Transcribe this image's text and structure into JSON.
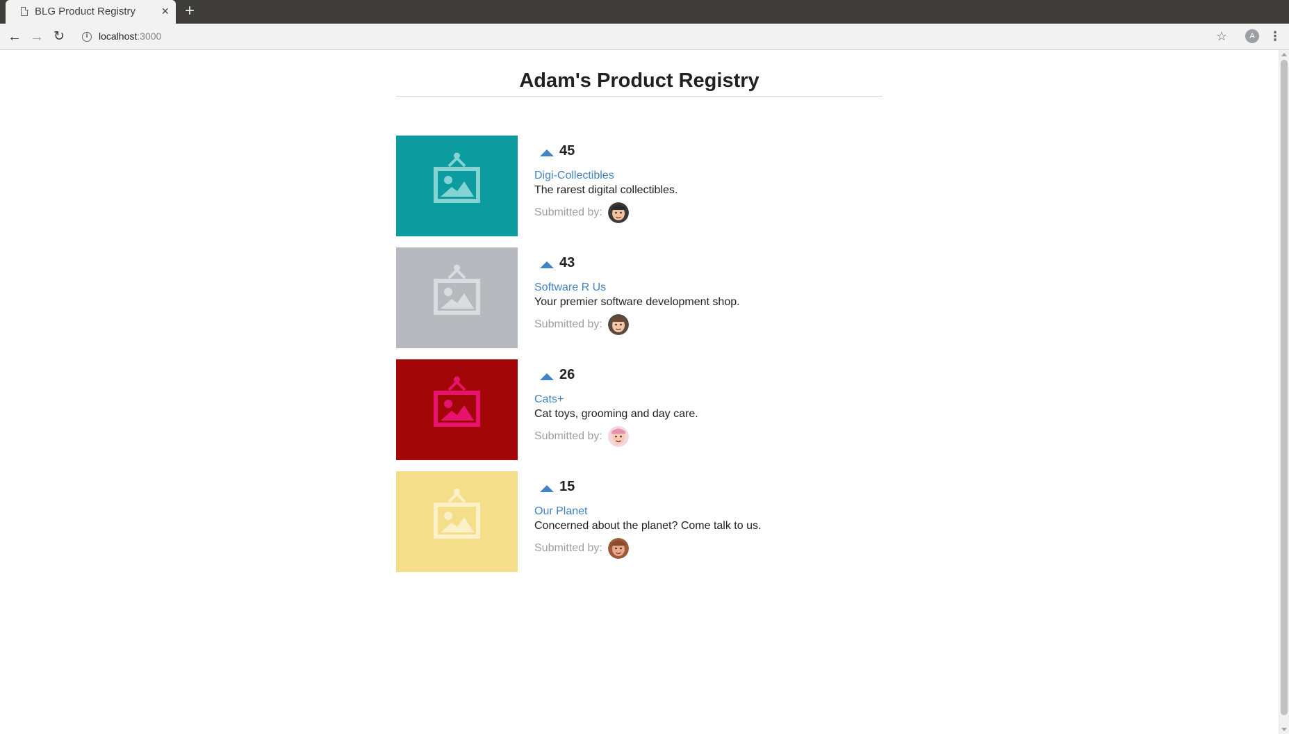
{
  "browser": {
    "tab_title": "BLG Product Registry",
    "tab_close": "×",
    "new_tab": "+",
    "url_host": "localhost",
    "url_port": ":3000",
    "profile_initial": "A",
    "icons": {
      "back": "back-arrow-icon",
      "forward": "forward-arrow-icon",
      "reload": "reload-icon",
      "info": "info-icon",
      "star": "star-icon",
      "menu": "kebab-menu-icon"
    }
  },
  "page": {
    "title": "Adam's Product Registry"
  },
  "products": [
    {
      "votes": "45",
      "title": "Digi-Collectibles",
      "description": "The rarest digital collectibles.",
      "submitted_label": "Submitted by:",
      "image_bg": "#0c9ca0",
      "image_fg": "#86d3d4",
      "avatar": {
        "skin": "#f2c29c",
        "hair": "#2b2b2b",
        "bg": "#3a3a3a"
      }
    },
    {
      "votes": "43",
      "title": "Software R Us",
      "description": "Your premier software development shop.",
      "submitted_label": "Submitted by:",
      "image_bg": "#b6b9be",
      "image_fg": "#dbdcdf",
      "avatar": {
        "skin": "#f3c6a6",
        "hair": "#6b4a33",
        "bg": "#5a4a3e"
      }
    },
    {
      "votes": "26",
      "title": "Cats+",
      "description": "Cat toys, grooming and day care.",
      "submitted_label": "Submitted by:",
      "image_bg": "#a30606",
      "image_fg": "#e8136e",
      "avatar": {
        "skin": "#f6c9b0",
        "hair": "#e58fb1",
        "bg": "#f3d7de"
      }
    },
    {
      "votes": "15",
      "title": "Our Planet",
      "description": "Concerned about the planet? Come talk to us.",
      "submitted_label": "Submitted by:",
      "image_bg": "#f5de8a",
      "image_fg": "#fbf0c8",
      "avatar": {
        "skin": "#e9a889",
        "hair": "#8a4a2c",
        "bg": "#9b5a3a"
      }
    }
  ],
  "colors": {
    "link": "#4183c4",
    "upvote": "#4183c4",
    "text": "#212121",
    "muted": "#9e9e9e"
  }
}
